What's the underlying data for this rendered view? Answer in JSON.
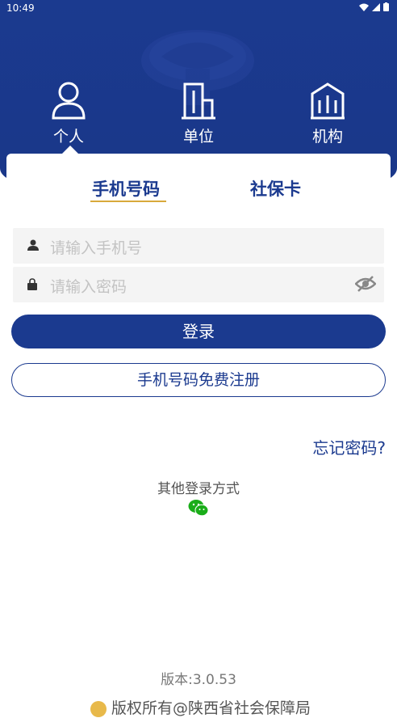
{
  "status_bar": {
    "time": "10:49"
  },
  "user_types": [
    {
      "label": "个人",
      "icon": "person-icon"
    },
    {
      "label": "单位",
      "icon": "building-icon"
    },
    {
      "label": "机构",
      "icon": "institution-icon"
    }
  ],
  "tabs": [
    {
      "label": "手机号码",
      "active": true
    },
    {
      "label": "社保卡",
      "active": false
    }
  ],
  "form": {
    "phone_placeholder": "请输入手机号",
    "password_placeholder": "请输入密码",
    "login_label": "登录",
    "register_label": "手机号码免费注册",
    "forgot_label": "忘记密码?"
  },
  "other_login": {
    "label": "其他登录方式",
    "icon": "wechat-icon"
  },
  "footer": {
    "version": "版本:3.0.53",
    "copyright": "版权所有@陕西省社会保障局"
  },
  "colors": {
    "primary": "#1b3a8f",
    "accent": "#d8a93b",
    "wechat": "#1aad19"
  }
}
